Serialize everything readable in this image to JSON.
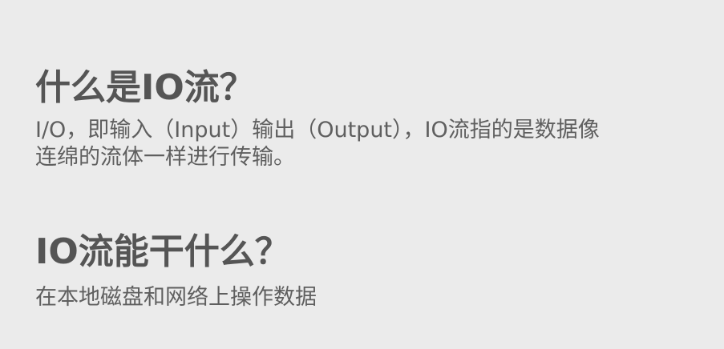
{
  "sections": [
    {
      "heading": "什么是IO流？",
      "body_line1": "I/O，即输入（Input）输出（Output），IO流指的是数据像",
      "body_line2": "连绵的流体一样进行传输。"
    },
    {
      "heading": "IO流能干什么？",
      "body": "在本地磁盘和网络上操作数据"
    }
  ]
}
